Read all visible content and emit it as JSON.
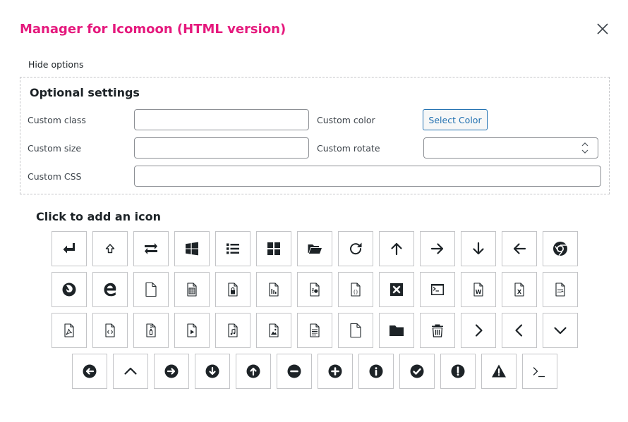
{
  "dialog": {
    "title": "Manager for Icomoon (HTML version)",
    "close_icon": "close-icon"
  },
  "options": {
    "toggle_label": "Hide options",
    "heading": "Optional settings",
    "custom_class_label": "Custom class",
    "custom_class_value": "",
    "custom_color_label": "Custom color",
    "select_color_label": "Select Color",
    "custom_size_label": "Custom size",
    "custom_size_value": "",
    "custom_rotate_label": "Custom rotate",
    "custom_rotate_value": "",
    "custom_css_label": "Custom CSS",
    "custom_css_value": ""
  },
  "icons": {
    "heading": "Click to add an icon",
    "items": [
      "enter-icon",
      "shift-icon",
      "swap-arrows-icon",
      "windows-icon",
      "list-icon",
      "grid-icon",
      "folder-open-icon",
      "redo-icon",
      "arrow-up-icon",
      "arrow-right-icon",
      "arrow-down-icon",
      "arrow-left-icon",
      "chrome-icon",
      "firefox-icon",
      "edge-icon",
      "file-empty-icon",
      "file-spreadsheet-icon",
      "file-locked-icon",
      "file-chart-icon",
      "file-stats-icon",
      "file-code-icon",
      "close-box-icon",
      "terminal-window-icon",
      "file-word-icon",
      "file-excel-icon",
      "file-text-icon",
      "file-pdf-icon",
      "file-xml-icon",
      "file-zip-icon",
      "file-video-icon",
      "file-audio-icon",
      "file-image-icon",
      "file-text-lines-icon",
      "file-blank-icon",
      "folder-icon",
      "trash-icon",
      "chevron-right-icon",
      "chevron-left-icon",
      "chevron-down-icon",
      "circle-arrow-left-icon",
      "chevron-up-icon",
      "circle-arrow-right-icon",
      "circle-arrow-down-icon",
      "circle-arrow-up-icon",
      "circle-minus-icon",
      "circle-plus-icon",
      "circle-info-icon",
      "circle-check-icon",
      "circle-exclamation-icon",
      "warning-icon",
      "terminal-prompt-icon"
    ]
  },
  "colors": {
    "title": "#e5197d",
    "button_accent": "#2271b1",
    "icon": "#1d2327",
    "border": "#c3c4c7"
  }
}
